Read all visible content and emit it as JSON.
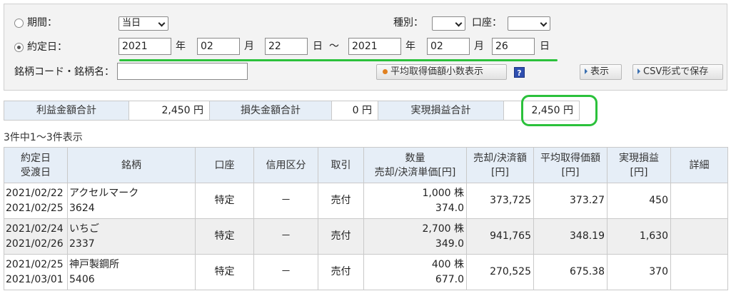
{
  "search": {
    "period_label": "期間：",
    "period_select": "当日",
    "trade_date_label": "約定日：",
    "date_from": {
      "year": "2021",
      "month": "02",
      "day": "22"
    },
    "date_to": {
      "year": "2021",
      "month": "02",
      "day": "26"
    },
    "unit_year": "年",
    "unit_month": "月",
    "unit_day": "日",
    "range_sep": "～",
    "type_label": "種別：",
    "type_select": "",
    "account_label": "口座：",
    "account_select": "",
    "code_label": "銘柄コード・銘柄名：",
    "code_value": "",
    "avg_price_button": "平均取得価額小数表示",
    "help_icon_label": "?",
    "show_button": "表示",
    "csv_button": "CSV形式で保存"
  },
  "summary": {
    "profit_label": "利益金額合計",
    "profit_value": "2,450 円",
    "loss_label": "損失金額合計",
    "loss_value": "0 円",
    "realized_label": "実現損益合計",
    "realized_value": "2,450 円"
  },
  "result_count": "3件中1～3件表示",
  "table": {
    "headers": {
      "date_1": "約定日",
      "date_2": "受渡日",
      "stock": "銘柄",
      "account": "口座",
      "margin": "信用区分",
      "trade": "取引",
      "qty_1": "数量",
      "qty_2": "売却/決済単価[円]",
      "amount_1": "売却/決済額",
      "amount_2": "[円]",
      "avg_1": "平均取得価額",
      "avg_2": "[円]",
      "pl_1": "実現損益",
      "pl_2": "[円]",
      "detail": "詳細"
    },
    "rows": [
      {
        "trade_date": "2021/02/22",
        "settle_date": "2021/02/25",
        "name": "アクセルマーク",
        "code": "3624",
        "account": "特定",
        "margin": "－",
        "trade": "売付",
        "qty": "1,000 株",
        "price": "374.0",
        "amount": "373,725",
        "avg": "373.27",
        "pl": "450"
      },
      {
        "trade_date": "2021/02/24",
        "settle_date": "2021/02/26",
        "name": "いちご",
        "code": "2337",
        "account": "特定",
        "margin": "－",
        "trade": "売付",
        "qty": "2,700 株",
        "price": "349.0",
        "amount": "941,765",
        "avg": "348.19",
        "pl": "1,630"
      },
      {
        "trade_date": "2021/02/25",
        "settle_date": "2021/03/01",
        "name": "神戸製鋼所",
        "code": "5406",
        "account": "特定",
        "margin": "－",
        "trade": "売付",
        "qty": "400 株",
        "price": "677.0",
        "amount": "270,525",
        "avg": "675.38",
        "pl": "370"
      }
    ]
  },
  "colors": {
    "highlight_green": "#2bc13b",
    "header_blue": "#e6eef7",
    "panel_gray": "#f3f3f3",
    "help_blue": "#2f4fb0"
  }
}
